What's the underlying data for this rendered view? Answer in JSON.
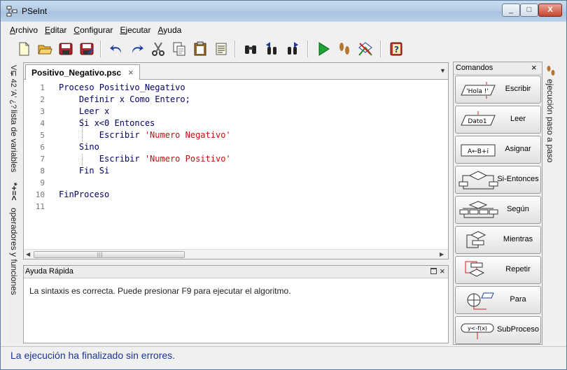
{
  "window": {
    "title": "PSeInt",
    "min": "_",
    "max": "□",
    "close": "X"
  },
  "menu": [
    "Archivo",
    "Editar",
    "Configurar",
    "Ejecutar",
    "Ayuda"
  ],
  "toolbar_icons": [
    "new-file-icon",
    "open-folder-icon",
    "save-icon",
    "save-as-icon",
    "undo-icon",
    "redo-icon",
    "cut-icon",
    "copy-icon",
    "paste-icon",
    "edit-list-icon",
    "find-icon",
    "find-previous-icon",
    "find-next-icon",
    "run-icon",
    "step-by-step-icon",
    "flowchart-icon",
    "help-icon"
  ],
  "left_strip": {
    "variables_label": "lista de variables",
    "variables_glyphs": "V⋤ 42 'A' ¿?",
    "operators_label": "operadores y funciones",
    "operators_glyphs": "*+=<"
  },
  "editor": {
    "tab_label": "Positivo_Negativo.psc",
    "tab_close": "×",
    "menu_arrow": "▼",
    "lines": [
      {
        "n": "1",
        "text": "Proceso Positivo_Negativo"
      },
      {
        "n": "2",
        "text": "    Definir x Como Entero;"
      },
      {
        "n": "3",
        "text": "    Leer x"
      },
      {
        "n": "4",
        "text": "    Si x<0 Entonces"
      },
      {
        "n": "5",
        "text": "        Escribir ",
        "str": "'Numero Negativo'"
      },
      {
        "n": "6",
        "text": "    Sino"
      },
      {
        "n": "7",
        "text": "        Escribir ",
        "str": "'Numero Positivo'"
      },
      {
        "n": "8",
        "text": "    Fin Si"
      },
      {
        "n": "9",
        "text": ""
      },
      {
        "n": "10",
        "text": "FinProceso"
      },
      {
        "n": "11",
        "text": ""
      }
    ],
    "scroll_left": "◀",
    "scroll_right": "▶",
    "scroll_grip": "|||"
  },
  "help": {
    "title": "Ayuda Rápida",
    "close": "×",
    "text": "La sintaxis es correcta. Puede presionar F9 para ejecutar el algoritmo."
  },
  "status": "La ejecución ha finalizado sin errores.",
  "commands": {
    "title": "Comandos",
    "close": "×",
    "items": [
      {
        "label": "Escribir",
        "icon_text": "'Hola !'"
      },
      {
        "label": "Leer",
        "icon_text": "Dato1"
      },
      {
        "label": "Asignar",
        "icon_text": "A←B+i"
      },
      {
        "label": "Si-Entonces",
        "icon_text": ""
      },
      {
        "label": "Según",
        "icon_text": ""
      },
      {
        "label": "Mientras",
        "icon_text": ""
      },
      {
        "label": "Repetir",
        "icon_text": ""
      },
      {
        "label": "Para",
        "icon_text": ""
      },
      {
        "label": "SubProceso",
        "icon_text": "y<-f(x)"
      }
    ]
  },
  "right_strip": {
    "label": "ejecución paso a paso"
  }
}
